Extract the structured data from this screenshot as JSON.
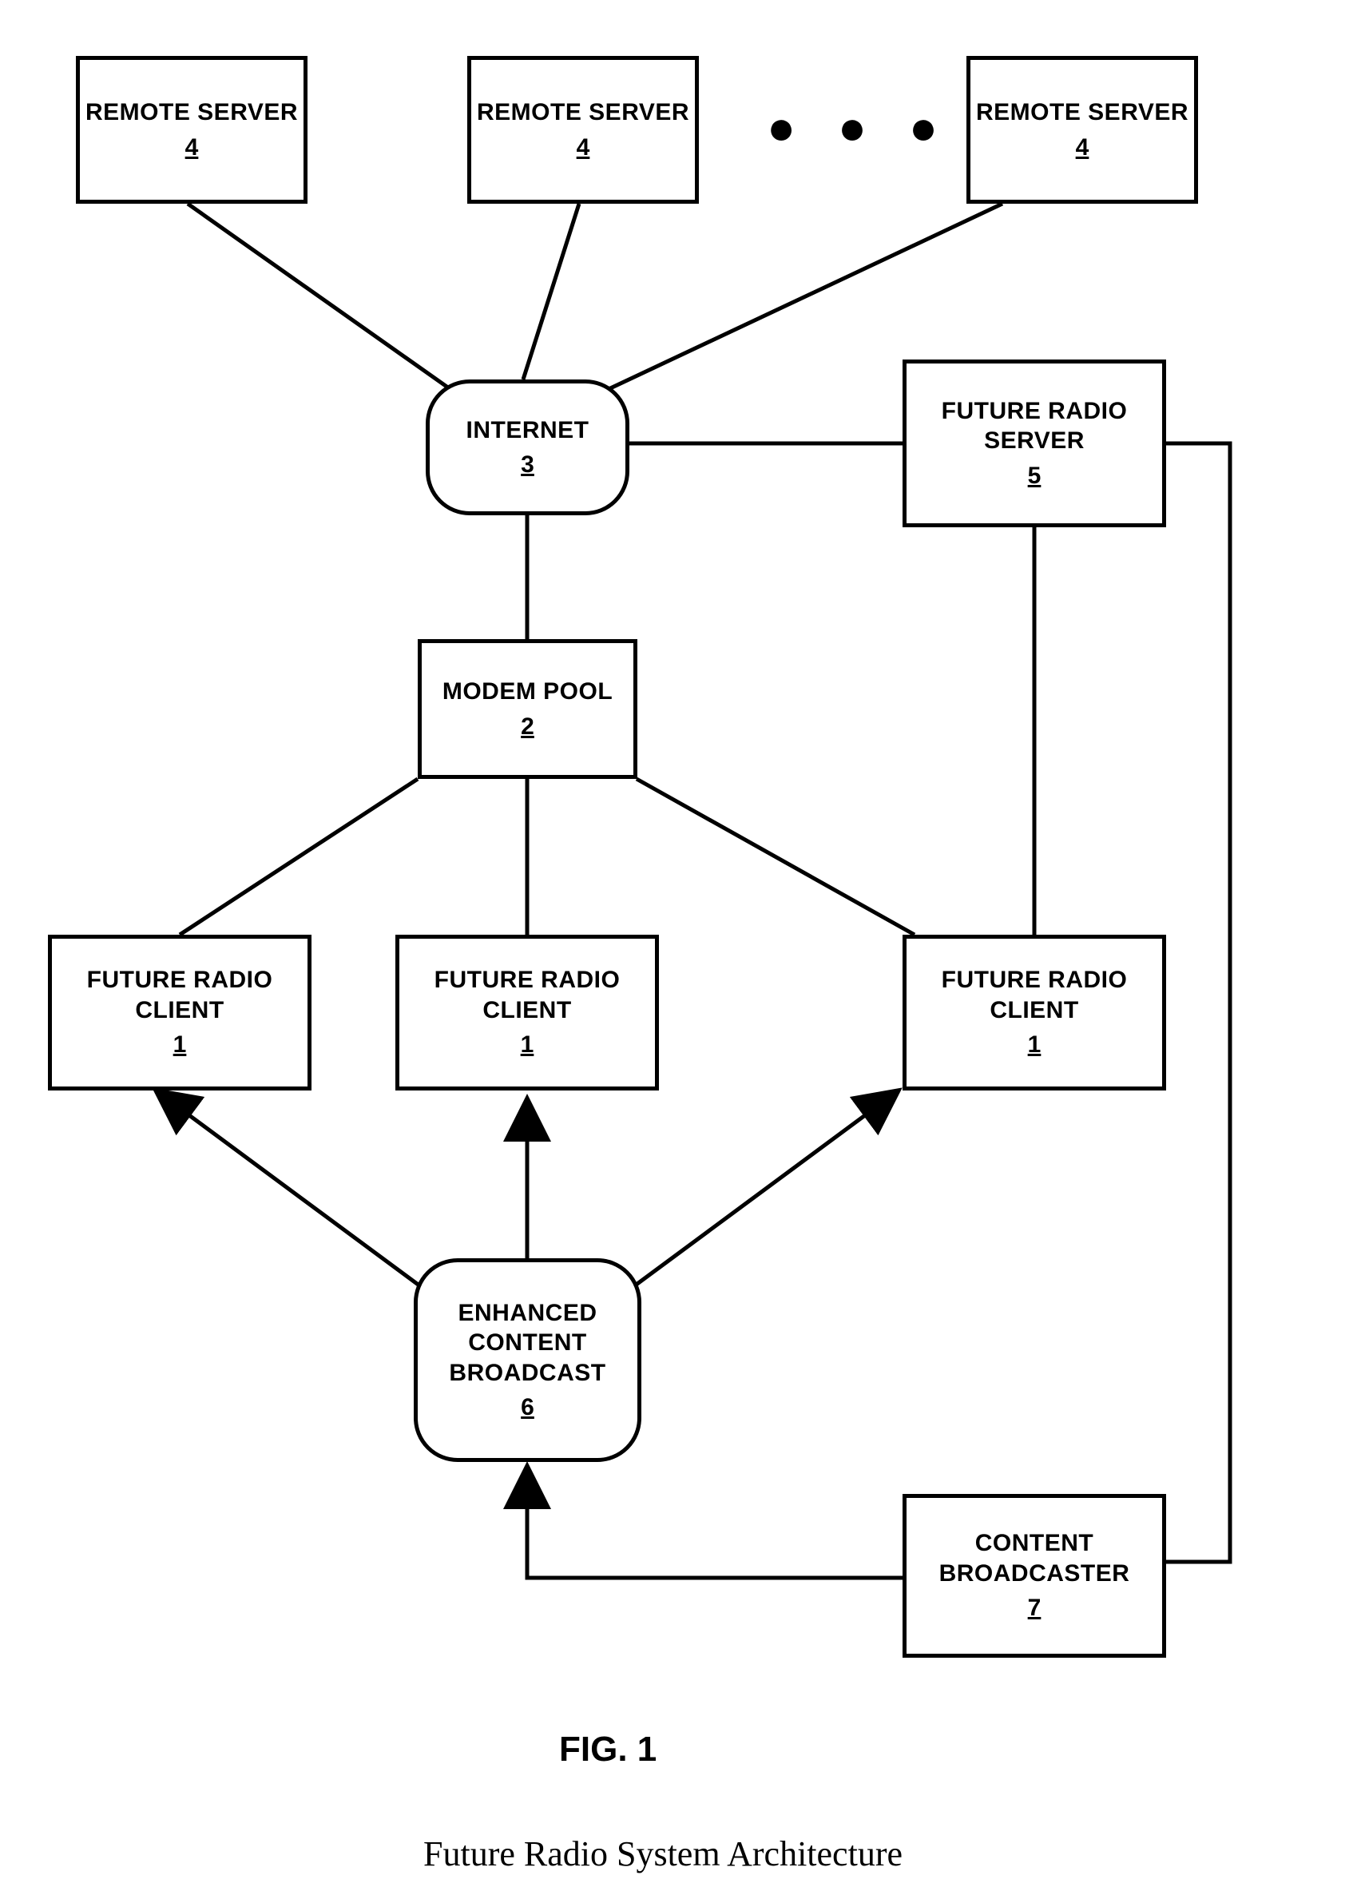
{
  "nodes": {
    "remote1": {
      "label": "REMOTE SERVER",
      "num": "4"
    },
    "remote2": {
      "label": "REMOTE SERVER",
      "num": "4"
    },
    "remote3": {
      "label": "REMOTE SERVER",
      "num": "4"
    },
    "internet": {
      "label": "INTERNET",
      "num": "3"
    },
    "frserver": {
      "label": "FUTURE RADIO SERVER",
      "num": "5"
    },
    "modem": {
      "label": "MODEM POOL",
      "num": "2"
    },
    "client1": {
      "label": "FUTURE RADIO CLIENT",
      "num": "1"
    },
    "client2": {
      "label": "FUTURE RADIO CLIENT",
      "num": "1"
    },
    "client3": {
      "label": "FUTURE RADIO CLIENT",
      "num": "1"
    },
    "enhanced": {
      "label": "ENHANCED CONTENT BROADCAST",
      "num": "6"
    },
    "cbroadcaster": {
      "label": "CONTENT BROADCASTER",
      "num": "7"
    }
  },
  "dots": "● ● ●",
  "figure": "FIG. 1",
  "caption": "Future Radio System Architecture"
}
